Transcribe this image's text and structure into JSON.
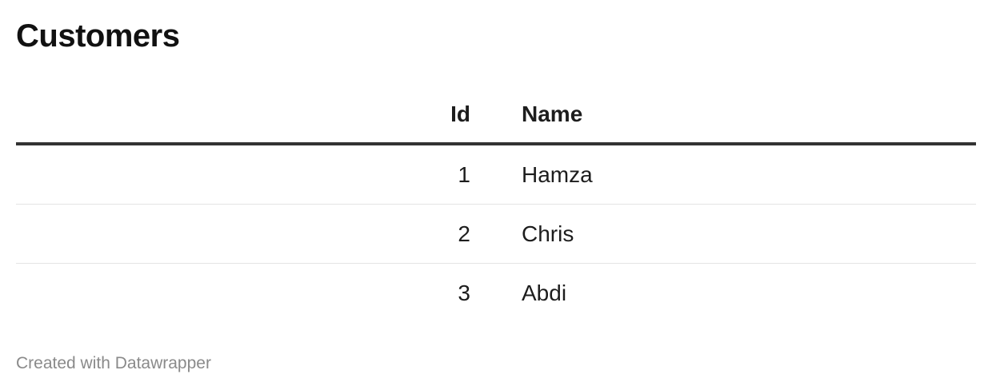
{
  "chart_data": {
    "type": "table",
    "title": "Customers",
    "columns": [
      "Id",
      "Name"
    ],
    "rows": [
      [
        "1",
        "Hamza"
      ],
      [
        "2",
        "Chris"
      ],
      [
        "3",
        "Abdi"
      ]
    ]
  },
  "footer": {
    "credit": "Created with Datawrapper"
  }
}
